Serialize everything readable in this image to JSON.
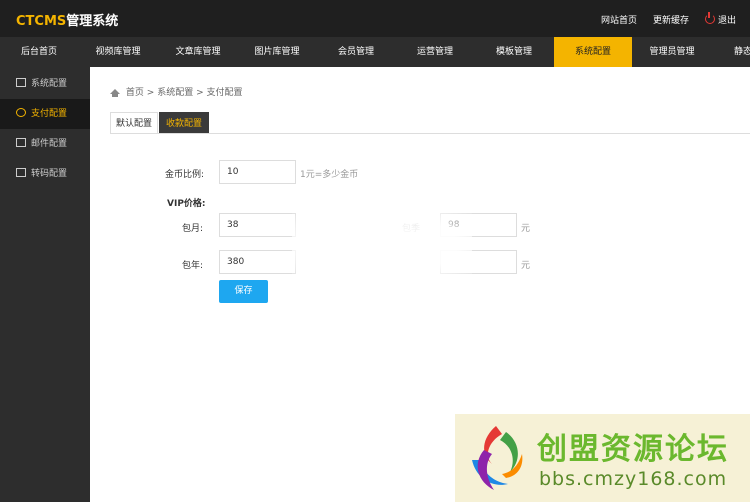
{
  "header": {
    "logo_brand": "CTCMS",
    "logo_suffix": "管理系统",
    "links": {
      "site_home": "网站首页",
      "update_cache": "更新缓存",
      "logout": "退出"
    }
  },
  "nav": {
    "items": [
      "后台首页",
      "视频库管理",
      "文章库管理",
      "图片库管理",
      "会员管理",
      "运营管理",
      "模板管理",
      "系统配置",
      "管理员管理",
      "静态"
    ],
    "active_index": 7
  },
  "sidebar": {
    "items": [
      "系统配置",
      "支付配置",
      "邮件配置",
      "转码配置"
    ],
    "active_index": 1
  },
  "breadcrumb": {
    "home": "首页",
    "sep": ">",
    "level1": "系统配置",
    "level2": "支付配置"
  },
  "tabs": {
    "default": "默认配置",
    "active": "收款配置"
  },
  "form": {
    "coin_label": "金币比例:",
    "coin_value": "10",
    "coin_hint": "1元=多少金币",
    "vip_title": "VIP价格:",
    "month_label": "包月:",
    "month_value": "38",
    "quarter_label": "包季",
    "quarter_value": "98",
    "year_label": "包年:",
    "year_value": "380",
    "unit": "元",
    "save_label": "保存"
  },
  "watermark": {
    "title": "创盟资源论坛",
    "url": "bbs.cmzy168.com"
  },
  "colors": {
    "accent": "#f4b400",
    "topbar": "#1f1f1f",
    "nav": "#2d2d2d",
    "button": "#1ea7f0"
  }
}
